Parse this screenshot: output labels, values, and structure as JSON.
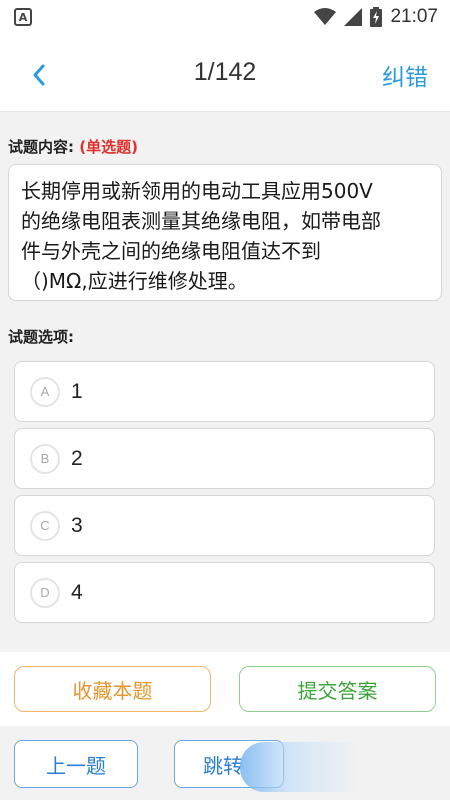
{
  "status_bar": {
    "app_icon_letter": "A",
    "time": "21:07",
    "icons": [
      "wifi-icon",
      "signal-icon",
      "battery-charging-icon"
    ]
  },
  "header": {
    "back_icon": "chevron-left-icon",
    "title": "1/142",
    "action_label": "纠错"
  },
  "question": {
    "label": "试题内容:",
    "type": "(单选题)",
    "lines": [
      "长期停用或新领用的电动工具应用500V",
      "的绝缘电阻表测量其绝缘电阻，如带电部",
      "件与外壳之间的绝缘电阻值达不到",
      "（)MΩ,应进行维修处理。"
    ]
  },
  "options_label": "试题选项:",
  "options": [
    {
      "letter": "A",
      "text": "1"
    },
    {
      "letter": "B",
      "text": "2"
    },
    {
      "letter": "C",
      "text": "3"
    },
    {
      "letter": "D",
      "text": "4"
    }
  ],
  "actions": {
    "favorite_label": "收藏本题",
    "submit_label": "提交答案"
  },
  "nav": {
    "prev_label": "上一题",
    "jump_label": "跳转"
  },
  "colors": {
    "accent_blue": "#2b9be0",
    "question_type_red": "#e0312e",
    "favorite_orange": "#e6962e",
    "submit_green": "#3aa43a"
  }
}
